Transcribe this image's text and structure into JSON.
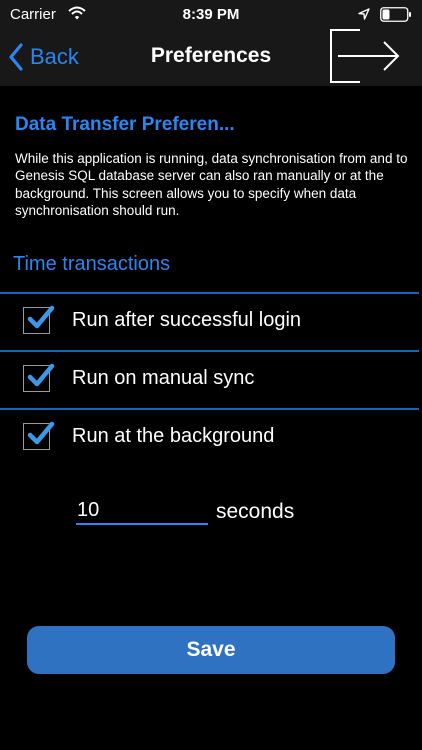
{
  "status_bar": {
    "carrier": "Carrier",
    "time": "8:39 PM"
  },
  "nav_bar": {
    "back_label": "Back",
    "title": "Preferences",
    "logout_icon": "logout-arrow-icon"
  },
  "content": {
    "heading": "Data Transfer Preferen...",
    "description": "While this application is running, data synchronisation from and to Genesis SQL database server can also ran manually or at the background. This screen allows you to specify when data synchronisation should run.",
    "group_title": "Time transactions",
    "options": [
      {
        "label": "Run after successful login",
        "checked": true
      },
      {
        "label": "Run on manual sync",
        "checked": true
      },
      {
        "label": "Run at the background",
        "checked": true
      }
    ],
    "interval": {
      "value": "10",
      "unit": "seconds"
    },
    "save_label": "Save"
  },
  "colors": {
    "accent": "#2a86f0",
    "divider": "#1565c0",
    "save_button": "#2f72c2",
    "background": "#000000",
    "bar_background": "#181818",
    "checkmark": "#3b9ae8"
  }
}
